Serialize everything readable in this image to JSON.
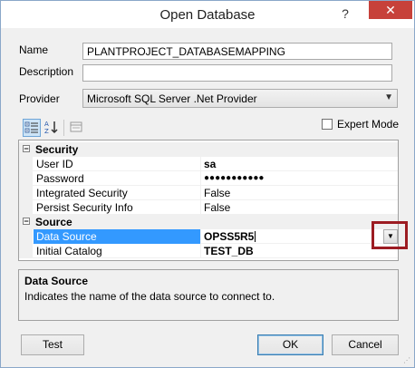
{
  "window": {
    "title": "Open Database",
    "help_glyph": "?",
    "close_glyph": "✕"
  },
  "form": {
    "name_label": "Name",
    "name_value": "PLANTPROJECT_DATABASEMAPPING",
    "description_label": "Description",
    "description_value": "",
    "provider_label": "Provider",
    "provider_value": "Microsoft SQL Server .Net Provider"
  },
  "toolbar": {
    "expert_mode_label": "Expert Mode",
    "expert_mode_checked": false
  },
  "grid": {
    "categories": [
      {
        "label": "Security",
        "properties": [
          {
            "name": "User ID",
            "value": "sa"
          },
          {
            "name": "Password",
            "value": "●●●●●●●●●●●"
          },
          {
            "name": "Integrated Security",
            "value": "False"
          },
          {
            "name": "Persist Security Info",
            "value": "False"
          }
        ]
      },
      {
        "label": "Source",
        "properties": [
          {
            "name": "Data Source",
            "value": "OPSS5R5"
          },
          {
            "name": "Initial Catalog",
            "value": "TEST_DB"
          }
        ]
      }
    ],
    "collapse_glyph": "−"
  },
  "description_panel": {
    "title": "Data Source",
    "text": "Indicates the name of the data source to connect to."
  },
  "buttons": {
    "test": "Test",
    "ok": "OK",
    "cancel": "Cancel"
  },
  "colors": {
    "selection": "#3399ff",
    "highlight_box": "#9c1c22",
    "close_button": "#c7413a"
  }
}
